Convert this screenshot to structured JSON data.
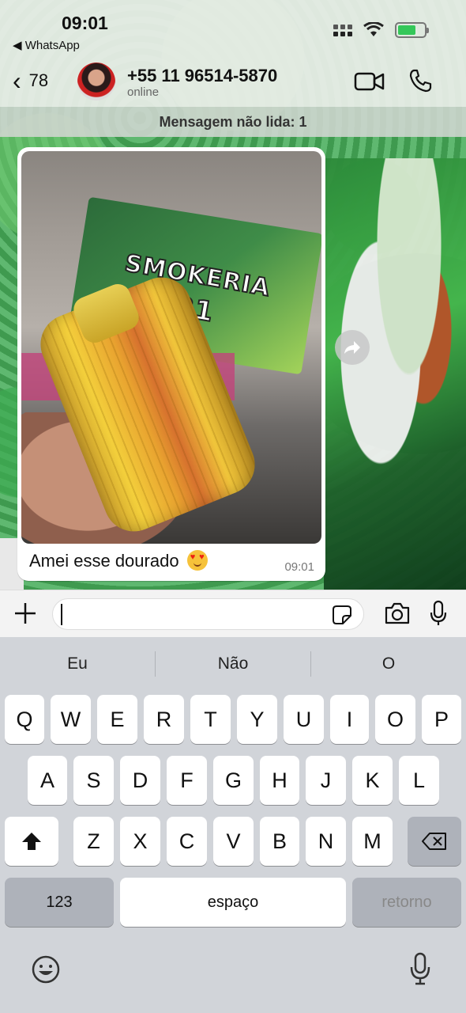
{
  "status_bar": {
    "time": "09:01",
    "back_app": "WhatsApp"
  },
  "header": {
    "back_count": "78",
    "contact_name": "+55 11 96514-5870",
    "contact_status": "online"
  },
  "unread_banner": "Mensagem não lida: 1",
  "message": {
    "image_text_line1": "SMOKERIA",
    "image_text_line2": "021",
    "caption": "Amei esse dourado",
    "time": "09:01"
  },
  "input": {
    "value": "",
    "placeholder": ""
  },
  "keyboard": {
    "suggestions": [
      "Eu",
      "Não",
      "O"
    ],
    "row1": [
      "Q",
      "W",
      "E",
      "R",
      "T",
      "Y",
      "U",
      "I",
      "O",
      "P"
    ],
    "row2": [
      "A",
      "S",
      "D",
      "F",
      "G",
      "H",
      "J",
      "K",
      "L"
    ],
    "row3": [
      "Z",
      "X",
      "C",
      "V",
      "B",
      "N",
      "M"
    ],
    "numbers_label": "123",
    "space_label": "espaço",
    "return_label": "retorno"
  },
  "icons": {
    "back": "chevron-left-icon",
    "video": "video-camera-icon",
    "call": "phone-icon",
    "forward": "forward-icon",
    "plus": "plus-icon",
    "sticker": "sticker-icon",
    "camera": "camera-icon",
    "mic": "microphone-icon",
    "shift": "shift-icon",
    "delete": "backspace-icon",
    "emoji": "emoji-icon",
    "dictation": "dictation-icon"
  },
  "colors": {
    "battery": "#34c759",
    "header_bg": "#ebeee9",
    "keyboard_bg": "#d1d4d9"
  }
}
